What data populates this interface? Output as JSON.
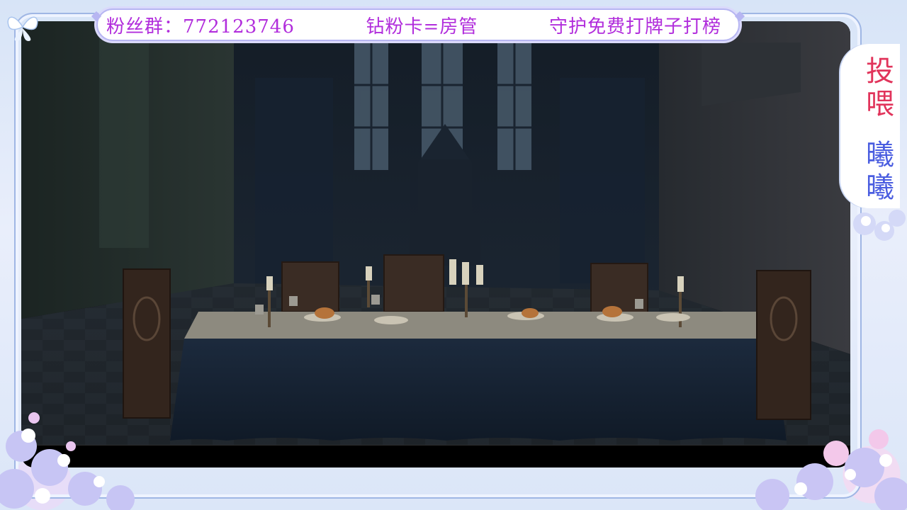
{
  "banner": {
    "group": "粉丝群：772123746",
    "card": "钻粉卡=房管",
    "guard": "守护免费打牌子打榜"
  },
  "side_label": {
    "top": "投喂",
    "bottom": "曦曦"
  },
  "colors": {
    "banner_text": "#b12ddc",
    "side_top": "#e1345b",
    "side_bottom": "#4a5de0",
    "frame_border": "#b7b6f2"
  },
  "icons": [
    "butterfly-icon",
    "flower-cluster-icon"
  ]
}
